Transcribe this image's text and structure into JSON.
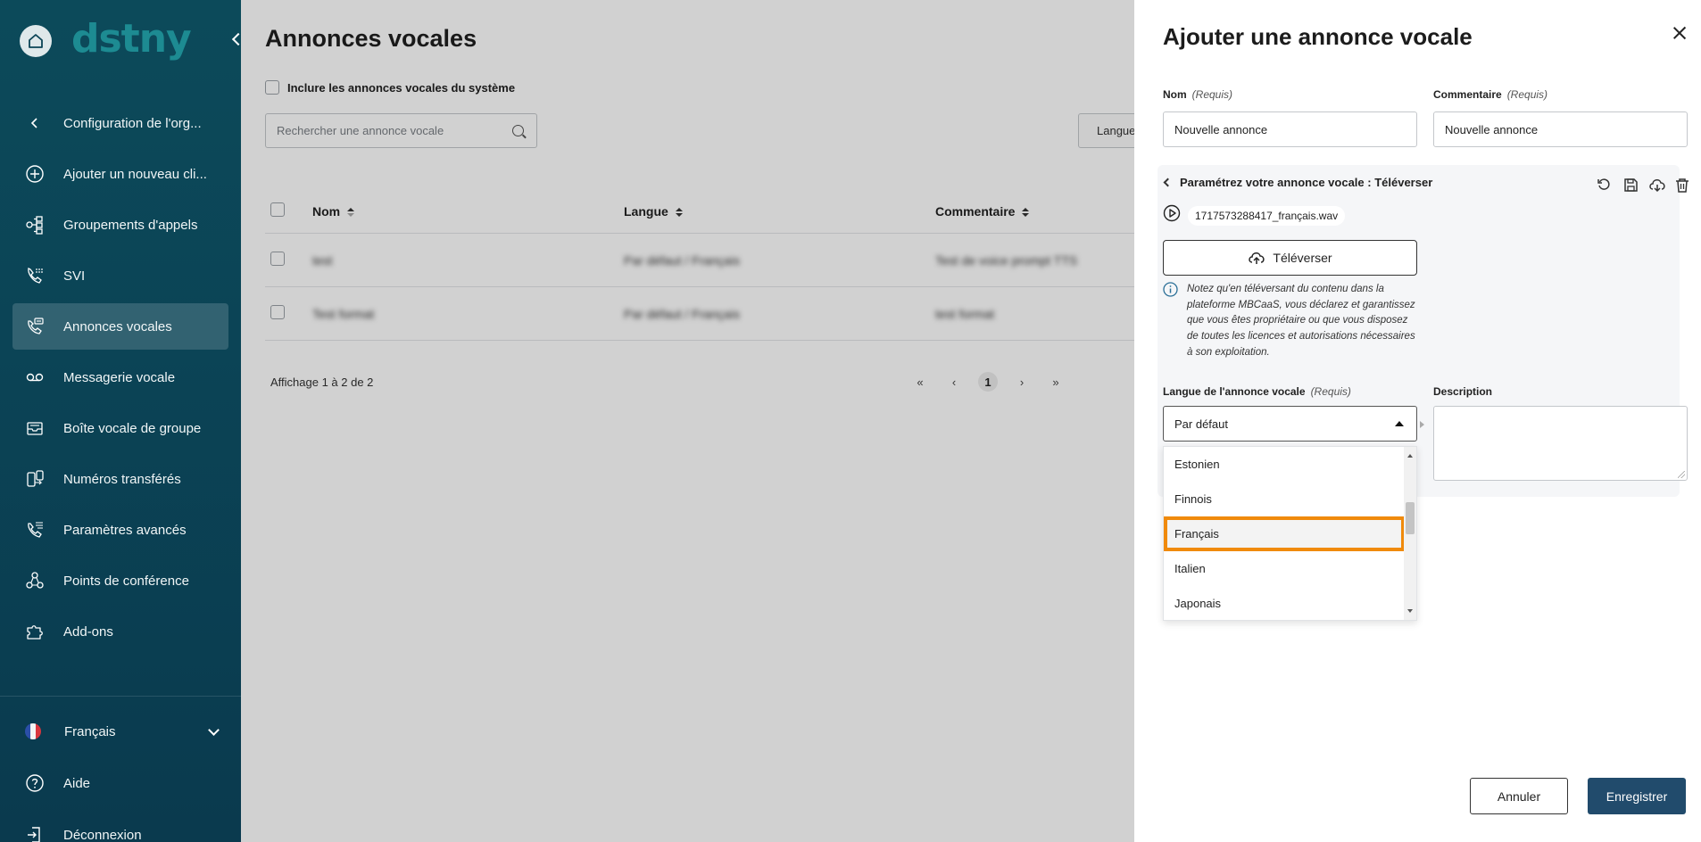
{
  "sidebar": {
    "logo": "dstny",
    "items": [
      {
        "label": "Configuration de l'org..."
      },
      {
        "label": "Ajouter un nouveau cli..."
      },
      {
        "label": "Groupements d'appels"
      },
      {
        "label": "SVI"
      },
      {
        "label": "Annonces vocales"
      },
      {
        "label": "Messagerie vocale"
      },
      {
        "label": "Boîte vocale de groupe"
      },
      {
        "label": "Numéros transférés"
      },
      {
        "label": "Paramètres avancés"
      },
      {
        "label": "Points de conférence"
      },
      {
        "label": "Add-ons"
      }
    ],
    "language": "Français",
    "help": "Aide",
    "logout": "Déconnexion"
  },
  "main": {
    "title": "Annonces vocales",
    "include_system": "Inclure les annonces vocales du système",
    "search_placeholder": "Rechercher une annonce vocale",
    "language_filter": "Langue",
    "columns": {
      "name": "Nom",
      "language": "Langue",
      "comment": "Commentaire"
    },
    "rows": [
      {
        "name": "test",
        "language": "Par défaut / Français",
        "comment": "Test de voice prompt TTS"
      },
      {
        "name": "Test format",
        "language": "Par défaut / Français",
        "comment": "test format"
      }
    ],
    "showing": "Affichage 1 à 2 de 2",
    "pagination": {
      "first": "«",
      "prev": "‹",
      "current": "1",
      "next": "›",
      "last": "»"
    }
  },
  "panel": {
    "title": "Ajouter une annonce vocale",
    "name": {
      "label": "Nom",
      "required": "(Requis)",
      "value": "Nouvelle annonce"
    },
    "comment": {
      "label": "Commentaire",
      "required": "(Requis)",
      "value": "Nouvelle annonce"
    },
    "configure_title": "Paramétrez votre annonce vocale : Téléverser",
    "file_name": "1717573288417_français.wav",
    "upload_button": "Téléverser",
    "notice": "Notez qu'en téléversant du contenu dans la plateforme MBCaaS, vous déclarez et garantissez que vous êtes propriétaire ou que vous disposez de toutes les licences et autorisations nécessaires à son exploitation.",
    "language": {
      "label": "Langue de l'annonce vocale",
      "required": "(Requis)",
      "value": "Par défaut"
    },
    "description": {
      "label": "Description"
    },
    "options": [
      "Estonien",
      "Finnois",
      "Français",
      "Italien",
      "Japonais"
    ],
    "selected_option": "Français",
    "cancel": "Annuler",
    "save": "Enregistrer"
  },
  "colors": {
    "sidebar_bg": "#0b4456",
    "logo": "#1d8b92",
    "primary_button": "#214b6c",
    "highlight": "#f08a0c"
  }
}
